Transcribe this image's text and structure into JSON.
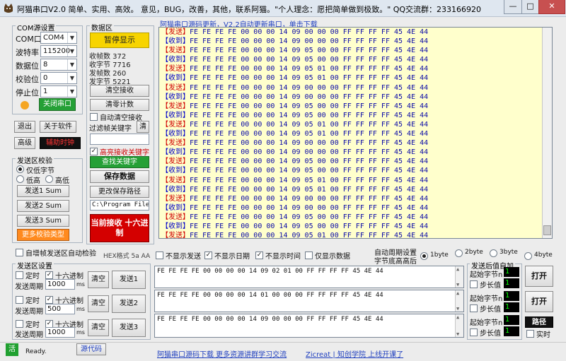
{
  "window": {
    "title": "阿猫串口V2.0  简单、实用、高效。  意见，BUG，改善，其他，联系阿猫。\"个人理念：愿把简单做到极致。\"  QQ交流群：233166920",
    "minimize": "—",
    "maximize": "□",
    "close": "✕"
  },
  "com_settings": {
    "group_label": "COM源设置",
    "port_label": "COM口",
    "port_value": "COM4",
    "baud_label": "波特率",
    "baud_value": "115200",
    "data_bits_label": "数据位",
    "data_bits_value": "8",
    "parity_label": "校验位",
    "parity_value": "0",
    "stop_bits_label": "停止位",
    "stop_bits_value": "1",
    "close_port_button": "关闭串口",
    "status_color": "#f5a623"
  },
  "left_buttons": {
    "exit": "退出",
    "about": "关于软件",
    "advanced": "高级",
    "aux_clock": "辅助时钟"
  },
  "checksum": {
    "group_label": "发送区校验",
    "low_high_option": "仅低字节",
    "low_option": "低高",
    "high_option": "高低",
    "send1_sum": "发送1 Sum",
    "send2_sum": "发送2 Sum",
    "send3_sum": "发送3 Sum",
    "more_types": "更多校验类型"
  },
  "data_area": {
    "group_label": "数据区",
    "pause_button": "暂停显示",
    "recv_frames": "收帧数 372",
    "recv_bytes": "收字节 7716",
    "send_frames": "发帧数 260",
    "send_bytes": "发字节 5221",
    "clear_recv": "清空接收",
    "clear_count": "清零计数",
    "auto_clear": "自动清空接收",
    "filter_label": "过滤帧关键字",
    "filter_clear": "清",
    "highlight_label": "高亮接收关键字",
    "find_keyword": "查找关键字",
    "save_data": "保存数据",
    "change_path": "更改保存路径",
    "path_value": "C:\\Program Files",
    "recv_mode": "当前接收 十六进制"
  },
  "recv_header": {
    "update_link": "阿猫串口源码更新，V2.2自动更新串口，单击下载"
  },
  "recv_log": [
    {
      "tag": "【发送】",
      "hex": "FE FE FE FE 00 00 00 14 09 00 00 00 FF FF FF FF 45 4E 44"
    },
    {
      "tag": "【收到】",
      "hex": "FE FE FE FE 00 00 00 14 09 00 00 00 FF FF FF FF 45 4E 44"
    },
    {
      "tag": "【发送】",
      "hex": "FE FE FE FE 00 00 00 14 09 05 00 00 FF FF FF FF 45 4E 44"
    },
    {
      "tag": "【收到】",
      "hex": "FE FE FE FE 00 00 00 14 09 05 00 00 FF FF FF FF 45 4E 44"
    },
    {
      "tag": "【发送】",
      "hex": "FE FE FE FE 00 00 00 14 09 05 01 00 FF FF FF FF 45 4E 44"
    },
    {
      "tag": "【收到】",
      "hex": "FE FE FE FE 00 00 00 14 09 05 01 00 FF FF FF FF 45 4E 44"
    },
    {
      "tag": "【发送】",
      "hex": "FE FE FE FE 00 00 00 14 09 00 00 00 FF FF FF FF 45 4E 44"
    },
    {
      "tag": "【收到】",
      "hex": "FE FE FE FE 00 00 00 14 09 00 00 00 FF FF FF FF 45 4E 44"
    },
    {
      "tag": "【发送】",
      "hex": "FE FE FE FE 00 00 00 14 09 05 00 00 FF FF FF FF 45 4E 44"
    },
    {
      "tag": "【收到】",
      "hex": "FE FE FE FE 00 00 00 14 09 05 00 00 FF FF FF FF 45 4E 44"
    },
    {
      "tag": "【发送】",
      "hex": "FE FE FE FE 00 00 00 14 09 05 01 00 FF FF FF FF 45 4E 44"
    },
    {
      "tag": "【收到】",
      "hex": "FE FE FE FE 00 00 00 14 09 05 01 00 FF FF FF FF 45 4E 44"
    },
    {
      "tag": "【发送】",
      "hex": "FE FE FE FE 00 00 00 14 09 00 00 00 FF FF FF FF 45 4E 44"
    },
    {
      "tag": "【收到】",
      "hex": "FE FE FE FE 00 00 00 14 09 00 00 00 FF FF FF FF 45 4E 44"
    },
    {
      "tag": "【发送】",
      "hex": "FE FE FE FE 00 00 00 14 09 05 00 00 FF FF FF FF 45 4E 44"
    },
    {
      "tag": "【收到】",
      "hex": "FE FE FE FE 00 00 00 14 09 05 00 00 FF FF FF FF 45 4E 44"
    },
    {
      "tag": "【发送】",
      "hex": "FE FE FE FE 00 00 00 14 09 05 01 00 FF FF FF FF 45 4E 44"
    },
    {
      "tag": "【收到】",
      "hex": "FE FE FE FE 00 00 00 14 09 05 01 00 FF FF FF FF 45 4E 44"
    },
    {
      "tag": "【发送】",
      "hex": "FE FE FE FE 00 00 00 14 09 00 00 00 FF FF FF FF 45 4E 44"
    },
    {
      "tag": "【收到】",
      "hex": "FE FE FE FE 00 00 00 14 09 00 00 00 FF FF FF FF 45 4E 44"
    },
    {
      "tag": "【发送】",
      "hex": "FE FE FE FE 00 00 00 14 09 05 00 00 FF FF FF FF 45 4E 44"
    },
    {
      "tag": "【收到】",
      "hex": "FE FE FE FE 00 00 00 14 09 05 00 00 FF FF FF FF 45 4E 44"
    },
    {
      "tag": "【发送】",
      "hex": "FE FE FE FE 00 00 00 14 09 05 01 00 FF FF FF FF 45 4E 44"
    }
  ],
  "display_options": {
    "hex_format": "HEX格式 5a AA",
    "hide_send": "不显示发送",
    "hide_date": "不显示日期",
    "hide_time": "不显示时间",
    "only_data": "仅显示数据",
    "auto_add_label": "自增帧发送区自动检验",
    "cycle_label": "自动周期设置",
    "byte_order_label": "字节底高高后",
    "byte1": "1byte",
    "byte2": "2byte",
    "byte3": "3byte",
    "byte4": "4byte"
  },
  "send_area": {
    "group_label": "发送区设置",
    "timer_label": "定时",
    "hex_label": "十六进制",
    "period_label": "发送周期",
    "unit": "ms",
    "clear": "清空",
    "rows": [
      {
        "period": "1000",
        "send": "发送1",
        "content": "FE FE FE FE 00 00 00 00 14 09 02 01 00 FF FF FF FF 45 4E 44"
      },
      {
        "period": "500",
        "send": "发送2",
        "content": "FE FE FE FE 00 00 00 00 14 01 00 00 00 FF FF FF FF 45 4E 44"
      },
      {
        "period": "1000",
        "send": "发送3",
        "content": "FE FE FE FE 00 00 00 00 14 09 00 00 00 FF FF FF FF 45 4E 44"
      }
    ]
  },
  "auto_add": {
    "group_label": "发送后值自加",
    "start_byte": "起始字节n",
    "step": "步长值",
    "start_value": "1",
    "step_value": "1",
    "open": "打开",
    "path": "路径",
    "realtime": "实时"
  },
  "status_bar": {
    "active": "活",
    "ready": "Ready.",
    "source_code": "源代码",
    "link1": "阿猫串口源码下载 更多资源讲群学习交流",
    "link2": "Zicreat | 知创学院 上线开课了"
  }
}
